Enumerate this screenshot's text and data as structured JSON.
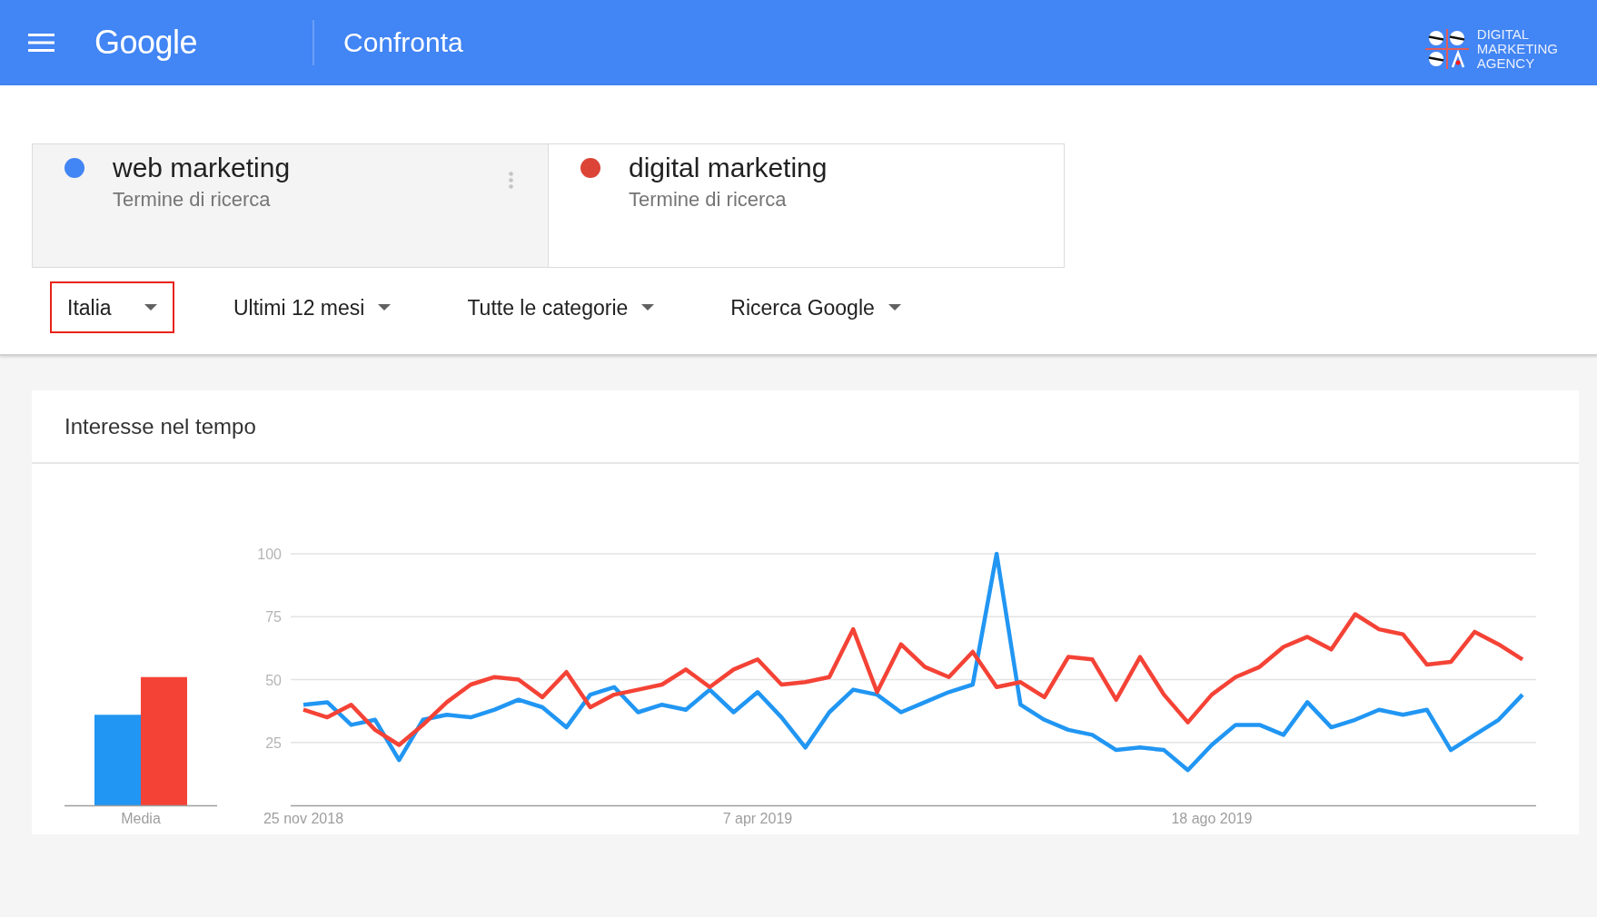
{
  "header": {
    "logo_text": "Google",
    "title": "Confronta",
    "agency_logo": {
      "lines": [
        "DIGITAL",
        "MARKETING",
        "AGENCY"
      ]
    }
  },
  "terms": [
    {
      "term": "web marketing",
      "subtitle": "Termine di ricerca",
      "color": "#4285f4",
      "selected": true
    },
    {
      "term": "digital marketing",
      "subtitle": "Termine di ricerca",
      "color": "#db4437",
      "selected": false
    }
  ],
  "filters": [
    {
      "label": "Italia",
      "highlighted": true
    },
    {
      "label": "Ultimi 12 mesi",
      "highlighted": false
    },
    {
      "label": "Tutte le categorie",
      "highlighted": false
    },
    {
      "label": "Ricerca Google",
      "highlighted": false
    }
  ],
  "interest_over_time": {
    "title": "Interesse nel tempo",
    "average": {
      "chart_data": {
        "type": "bar",
        "categories": [
          "Media"
        ],
        "ylim": [
          0,
          100
        ],
        "series": [
          {
            "color": "#2196f3",
            "values": [
              36
            ]
          },
          {
            "color": "#f44336",
            "values": [
              51
            ]
          }
        ]
      }
    },
    "trend": {
      "chart_data": {
        "type": "line",
        "grid": true,
        "categories": [
          "25 nov 2018",
          null,
          null,
          null,
          null,
          null,
          null,
          null,
          null,
          null,
          null,
          null,
          null,
          null,
          null,
          null,
          null,
          null,
          null,
          "7 apr 2019",
          null,
          null,
          null,
          null,
          null,
          null,
          null,
          null,
          null,
          null,
          null,
          null,
          null,
          null,
          null,
          null,
          null,
          null,
          "18 ago 2019",
          null,
          null,
          null,
          null,
          null,
          null,
          null,
          null,
          null,
          null,
          null,
          null,
          null
        ],
        "ylim": [
          0,
          100
        ],
        "yticks": [
          25,
          50,
          75,
          100
        ],
        "series": [
          {
            "color": "#2196f3",
            "values": [
              40,
              41,
              32,
              34,
              18,
              34,
              36,
              35,
              38,
              42,
              39,
              31,
              44,
              47,
              37,
              40,
              38,
              46,
              37,
              45,
              35,
              23,
              37,
              46,
              44,
              37,
              41,
              45,
              48,
              100,
              40,
              34,
              30,
              28,
              22,
              23,
              22,
              14,
              24,
              32,
              32,
              28,
              41,
              31,
              34,
              38,
              36,
              38,
              22,
              28,
              34,
              44
            ]
          },
          {
            "color": "#f44336",
            "values": [
              38,
              35,
              40,
              30,
              24,
              32,
              41,
              48,
              51,
              50,
              43,
              53,
              39,
              44,
              46,
              48,
              54,
              47,
              54,
              58,
              48,
              49,
              51,
              70,
              45,
              64,
              55,
              51,
              61,
              47,
              49,
              43,
              59,
              58,
              42,
              59,
              44,
              33,
              44,
              51,
              55,
              63,
              67,
              62,
              76,
              70,
              68,
              56,
              57,
              69,
              64,
              58
            ]
          }
        ]
      }
    }
  }
}
